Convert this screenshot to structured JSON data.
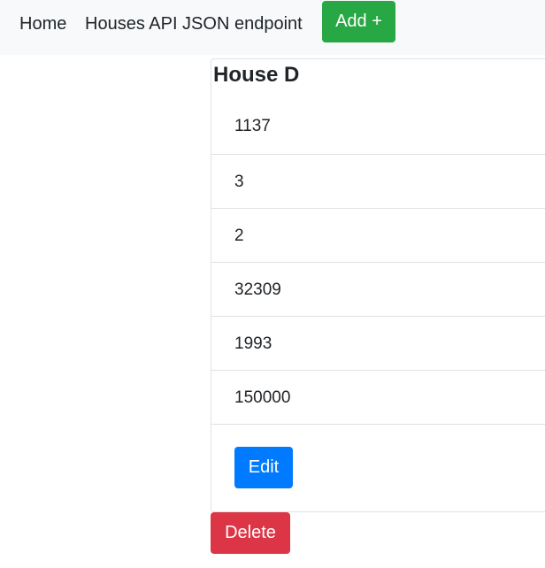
{
  "navbar": {
    "home_label": "Home",
    "api_label": "Houses API JSON endpoint",
    "add_label": "Add +"
  },
  "house": {
    "title": "House D",
    "fields": [
      "1137",
      "3",
      "2",
      "32309",
      "1993",
      "150000"
    ],
    "edit_label": "Edit",
    "delete_label": "Delete"
  },
  "colors": {
    "navbar_bg": "#f8f9fa",
    "add_button": "#28a745",
    "edit_button": "#007bff",
    "delete_button": "#dc3545"
  }
}
